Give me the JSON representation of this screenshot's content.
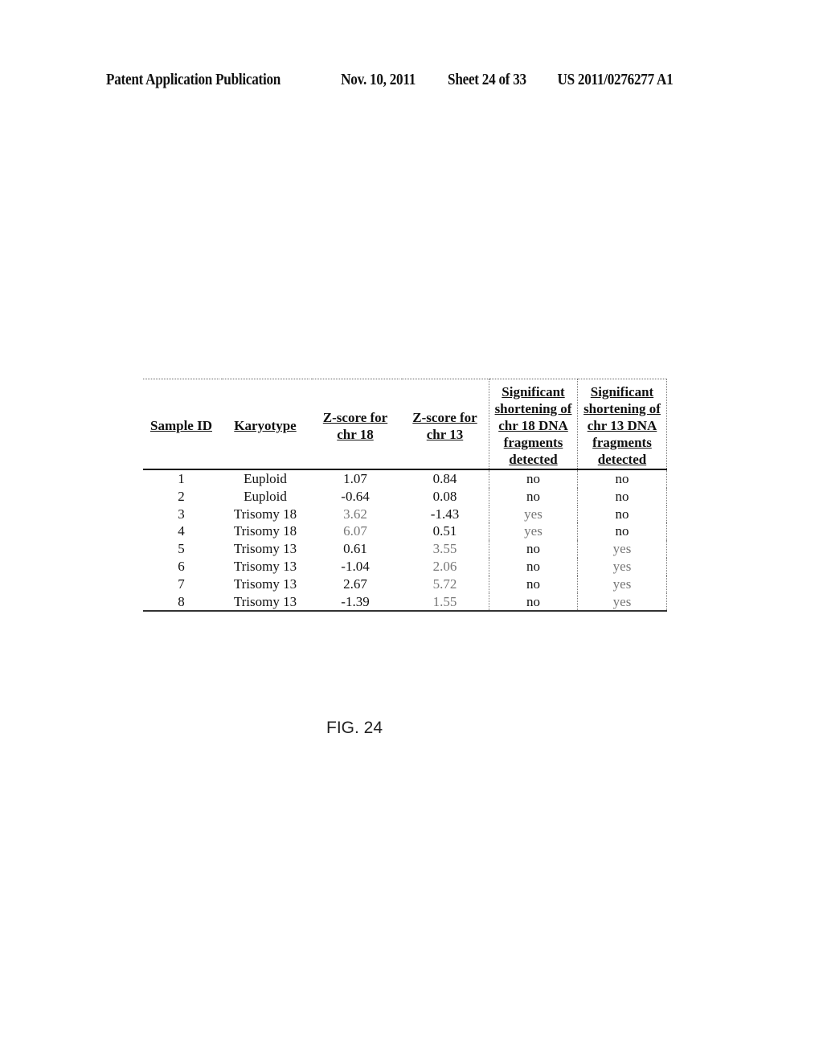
{
  "header": {
    "publication": "Patent Application Publication",
    "date": "Nov. 10, 2011",
    "sheet": "Sheet 24 of 33",
    "number": "US 2011/0276277 A1"
  },
  "table": {
    "columns": [
      [
        "Sample ID"
      ],
      [
        "Karyotype"
      ],
      [
        "Z-score for",
        "chr 18"
      ],
      [
        "Z-score for",
        "chr 13"
      ],
      [
        "Significant",
        "shortening of",
        "chr 18 DNA",
        "fragments",
        "detected"
      ],
      [
        "Significant",
        "shortening of",
        "chr 13 DNA",
        "fragments",
        "detected"
      ]
    ],
    "rows": [
      {
        "id": "1",
        "karyotype": "Euploid",
        "z18": "1.07",
        "z13": "0.84",
        "short18": "no",
        "short13": "no",
        "hl18": false,
        "hl13": false
      },
      {
        "id": "2",
        "karyotype": "Euploid",
        "z18": "-0.64",
        "z13": "0.08",
        "short18": "no",
        "short13": "no",
        "hl18": false,
        "hl13": false
      },
      {
        "id": "3",
        "karyotype": "Trisomy 18",
        "z18": "3.62",
        "z13": "-1.43",
        "short18": "yes",
        "short13": "no",
        "hl18": true,
        "hl13": false
      },
      {
        "id": "4",
        "karyotype": "Trisomy 18",
        "z18": "6.07",
        "z13": "0.51",
        "short18": "yes",
        "short13": "no",
        "hl18": true,
        "hl13": false
      },
      {
        "id": "5",
        "karyotype": "Trisomy 13",
        "z18": "0.61",
        "z13": "3.55",
        "short18": "no",
        "short13": "yes",
        "hl18": false,
        "hl13": true
      },
      {
        "id": "6",
        "karyotype": "Trisomy 13",
        "z18": "-1.04",
        "z13": "2.06",
        "short18": "no",
        "short13": "yes",
        "hl18": false,
        "hl13": false
      },
      {
        "id": "7",
        "karyotype": "Trisomy 13",
        "z18": "2.67",
        "z13": "5.72",
        "short18": "no",
        "short13": "yes",
        "hl18": false,
        "hl13": true
      },
      {
        "id": "8",
        "karyotype": "Trisomy 13",
        "z18": "-1.39",
        "z13": "1.55",
        "short18": "no",
        "short13": "yes",
        "hl18": false,
        "hl13": false
      }
    ]
  },
  "figure_label": "FIG. 24"
}
